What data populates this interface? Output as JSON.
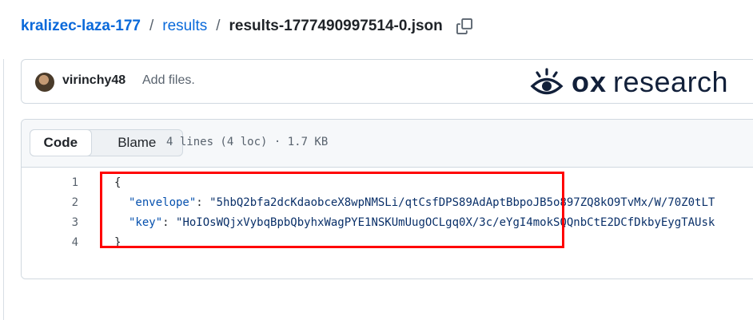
{
  "breadcrumb": {
    "repo": "kralizec-laza-177",
    "separator": "/",
    "folder": "results",
    "file": "results-1777490997514-0.json"
  },
  "icons": {
    "copy": "copy-icon",
    "logo": "eye-icon"
  },
  "commit": {
    "author": "virinchy48",
    "message": "Add files."
  },
  "logo": {
    "brand": "ox",
    "product": "research"
  },
  "file_viewer": {
    "tabs": [
      {
        "label": "Code",
        "selected": true
      },
      {
        "label": "Blame",
        "selected": false
      }
    ],
    "info": "4 lines (4 loc) · 1.7 KB"
  },
  "code": {
    "lines": [
      {
        "num": "1",
        "text": "{"
      },
      {
        "num": "2",
        "key": "\"envelope\"",
        "sep": ": ",
        "value": "\"5hbQ2bfa2dcKdaobceX8wpNMSLi/qtCsfDPS89AdAptBbpoJB5o897ZQ8kO9TvMx/W/70Z0tLT"
      },
      {
        "num": "3",
        "key": "\"key\"",
        "sep": ": ",
        "value": "\"HoIOsWQjxVybqBpbQbyhxWagPYE1NSKUmUugOCLgq0X/3c/eYgI4mokSQQnbCtE2DCfDkbyEygTAUsk"
      },
      {
        "num": "4",
        "text": "}"
      }
    ]
  },
  "colors": {
    "link": "#0969da",
    "json_key": "#0550ae",
    "json_string": "#0a3069",
    "highlight": "#ff0000"
  }
}
